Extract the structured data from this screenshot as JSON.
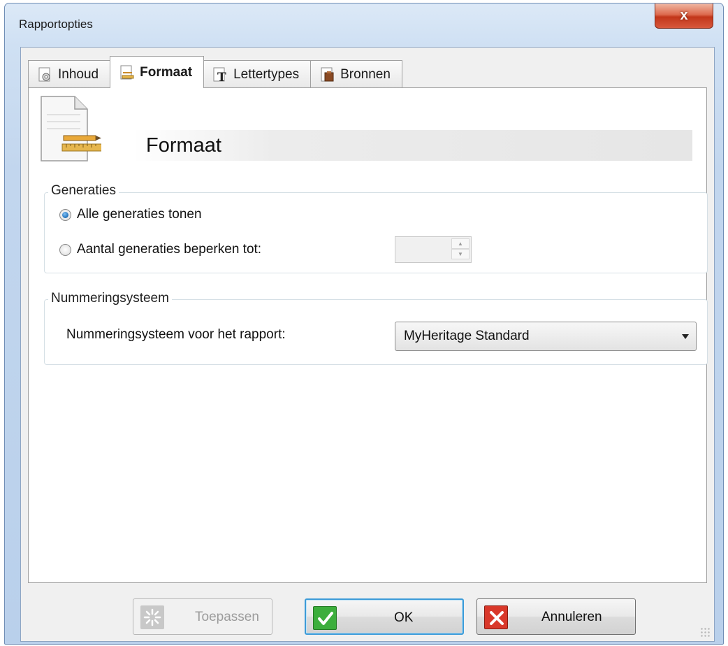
{
  "window": {
    "title": "Rapportopties",
    "close_label": "x"
  },
  "tabs": [
    {
      "label": "Inhoud",
      "icon": "gear-doc-icon"
    },
    {
      "label": "Formaat",
      "icon": "pencil-ruler-icon",
      "active": true
    },
    {
      "label": "Lettertypes",
      "icon": "font-icon"
    },
    {
      "label": "Bronnen",
      "icon": "archive-icon"
    }
  ],
  "page": {
    "title": "Formaat"
  },
  "generations": {
    "group_label": "Generaties",
    "option_all": "Alle generaties tonen",
    "option_limit": "Aantal generaties beperken tot:",
    "selected": "all",
    "limit_value": ""
  },
  "numbering": {
    "group_label": "Nummeringsysteem",
    "field_label": "Nummeringsysteem voor het rapport:",
    "selected_value": "MyHeritage Standard"
  },
  "buttons": {
    "apply": "Toepassen",
    "ok": "OK",
    "cancel": "Annuleren"
  },
  "colors": {
    "accent": "#3c9bd8",
    "ok_icon": "#3cae3c",
    "cancel_icon": "#d9382a",
    "close_button": "#c2361a"
  }
}
